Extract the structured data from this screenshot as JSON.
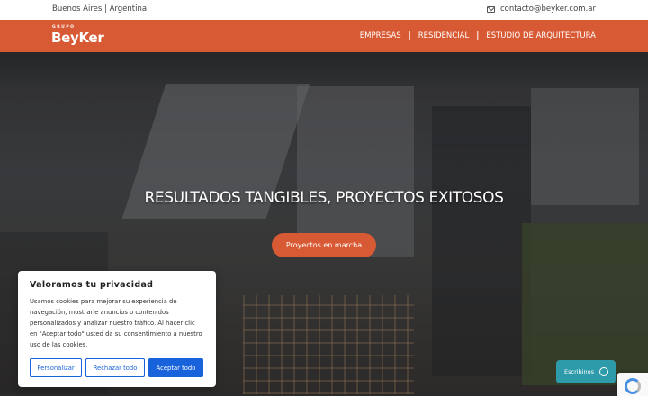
{
  "topbar": {
    "location": "Buenos Aires | Argentina",
    "email": "contacto@beyker.com.ar",
    "email_icon": "envelope-icon"
  },
  "header": {
    "logo_top": "GRUPO",
    "logo_brand": "BeyKer",
    "nav": [
      "EMPRESAS",
      "RESIDENCIAL",
      "ESTUDIO DE ARQUITECTURA"
    ],
    "accent_color": "#d85a34"
  },
  "hero": {
    "title": "RESULTADOS TANGIBLES, PROYECTOS EXITOSOS",
    "cta_label": "Proyectos en marcha"
  },
  "cookie": {
    "title": "Valoramos tu privacidad",
    "text": "Usamos cookies para mejorar su experiencia de navegación, mostrarle anuncios o contenidos personalizados y analizar nuestro tráfico. Al hacer clic en \"Aceptar todo\" usted da su consentimiento a nuestro uso de las cookies.",
    "btn_customize": "Personalizar",
    "btn_reject": "Rechazar todo",
    "btn_accept": "Aceptar todo",
    "button_color": "#1863dc"
  },
  "whatsapp": {
    "label": "Escribinos",
    "icon": "whatsapp-icon"
  },
  "recaptcha": {
    "icon": "recaptcha-icon"
  }
}
